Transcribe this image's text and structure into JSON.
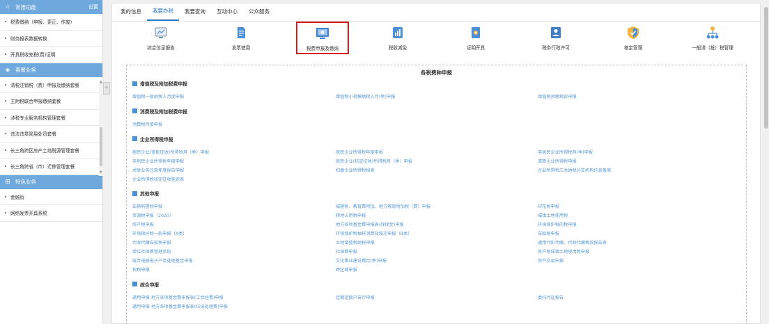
{
  "sidebar": {
    "common": {
      "title": "常用功能",
      "settings": "设置",
      "icon": "star-icon"
    },
    "common_items": [
      "税费缴纳（申报、更正、作废）",
      "财务报表数据转换",
      "开具税收完税(费)证明"
    ],
    "package": {
      "title": "套餐业务",
      "icon": "layers-icon"
    },
    "package_items": [
      "清税注销税（费）申报及缴纳套餐",
      "主附税联合申报缴纳套餐",
      "涉税专业服务机构管理套餐",
      "违法违章简易处罚套餐",
      "长三角跨区房产土地税源管理套餐",
      "长三角跨省（市）迁移管理套餐"
    ],
    "special": {
      "title": "特色业务",
      "icon": "grid-icon"
    },
    "special_items": [
      "金融街",
      "网络发票开具系统"
    ],
    "collapse": "«"
  },
  "tabs": [
    "我的信息",
    "我要办税",
    "我要查询",
    "互动中心",
    "公众服务"
  ],
  "active_tab": "我要办税",
  "functions": [
    {
      "label": "综合信息报告",
      "icon": "report-icon"
    },
    {
      "label": "发票使用",
      "icon": "invoice-icon"
    },
    {
      "label": "税费申报及缴纳",
      "icon": "monitor-icon"
    },
    {
      "label": "税收减免",
      "icon": "chart-bar-icon"
    },
    {
      "label": "证明开具",
      "icon": "certificate-icon"
    },
    {
      "label": "税务行政许可",
      "icon": "license-icon"
    },
    {
      "label": "核定管理",
      "icon": "shield-icon"
    },
    {
      "label": "一般退（抵）税管理",
      "icon": "network-icon"
    }
  ],
  "panel": {
    "title": "各税费种申报",
    "categories": [
      {
        "title": "增值税及附加税费申报",
        "links": [
          [
            "增值税一般纳税人月度申报",
            "增值税小规模纳税人月(季)申报",
            "增值税预缴税款申报"
          ]
        ]
      },
      {
        "title": "消费税及附加税费申报",
        "links": [
          [
            "消费税月度申报"
          ]
        ]
      },
      {
        "title": "企业所得税申报",
        "links": [
          [
            "居民企业(查账征收)所得税月（季）申报",
            "居民企业所得税年度申报",
            "非居民企业所得税月(季)申报"
          ],
          [
            "非居民企业所得税年度申报",
            "居民企业(核定征收)所得税月（季）申报",
            "清算企业所得税申报"
          ],
          [
            "关联业务往来年度报告申报",
            "扣缴企业所得税报表",
            "企业所得税汇总纳税分支机构信息备案"
          ],
          [
            "企业所得税核定征收鉴定表"
          ]
        ]
      },
      {
        "title": "其他申报",
        "links": [
          [
            "车辆购置税申报",
            "城建税、教育费附加、地方教育附加税（费）申报",
            "印花税申报"
          ],
          [
            "资源税申报（2020）",
            "耕地占用税申报",
            "城镇土地使用税"
          ],
          [
            "房产税申报",
            "地方各项基金费申报表(残保金)申报",
            "环境保护税的税申报"
          ],
          [
            "环境保护税一般申报（A类）",
            "环境保护税抽样测算及按次申报（B类）",
            "车船税申报"
          ],
          [
            "代收代缴车船税申报",
            "土地增值税纳税申报",
            "通用代扣代缴、代收代缴税款报告表"
          ],
          [
            "单位社保费管理系统",
            "社保费申报",
            "房产税城镇土地使用税申报"
          ],
          [
            "废弃电器电子产品处理基金申报",
            "文化事业建设费月(季)申报",
            "房产交易申报"
          ],
          [
            "契税申报",
            "跨区域申报"
          ]
        ]
      },
      {
        "title": "综合申报",
        "links": [
          [
            "通用申报-地方各项基金费申报表(工会经费)申报",
            "定期定额户自行申报",
            "委托代征报告"
          ],
          [
            "通用申报-地方各项基金费申报表(垃圾处理费)申报"
          ]
        ]
      }
    ]
  },
  "colors": {
    "accent": "#2f7ac8",
    "link": "#5b9bd5",
    "sidebar_header": "#6fa8dc",
    "highlight": "#d7191c"
  }
}
